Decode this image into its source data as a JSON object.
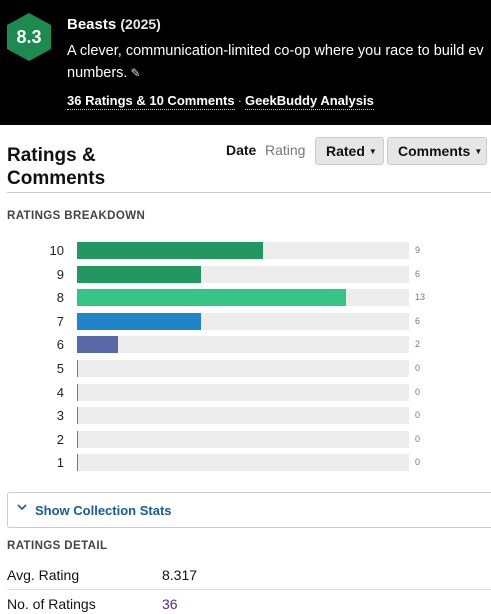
{
  "header": {
    "score": "8.3",
    "title": "Beasts",
    "year": "(2025)",
    "description": "A clever, communication-limited co-op where you race to build ev numbers.",
    "ratings_link": "36 Ratings & 10 Comments",
    "separator": "·",
    "analysis_link": "GeekBuddy Analysis"
  },
  "colors": {
    "header_bg": "#000000",
    "hex_fill": "#1d8a4f",
    "link_purple": "#5b2a86",
    "link_blue": "#1a5a9a"
  },
  "ratings_comments": {
    "title_line1": "Ratings &",
    "title_line2": "Comments",
    "sort_date": "Date",
    "sort_rating": "Rating",
    "filter_rated": "Rated",
    "filter_comments": "Comments"
  },
  "breakdown": {
    "heading": "RATINGS BREAKDOWN",
    "max": 13,
    "rows": [
      {
        "label": "10",
        "count": "9",
        "value": 9,
        "color": "#239760"
      },
      {
        "label": "9",
        "count": "6",
        "value": 6,
        "color": "#239760"
      },
      {
        "label": "8",
        "count": "13",
        "value": 13,
        "color": "#34c485"
      },
      {
        "label": "7",
        "count": "6",
        "value": 6,
        "color": "#1f85c8"
      },
      {
        "label": "6",
        "count": "2",
        "value": 2,
        "color": "#5a68a8"
      },
      {
        "label": "5",
        "count": "0",
        "value": 0,
        "color": "#d9534f"
      },
      {
        "label": "4",
        "count": "0",
        "value": 0,
        "color": "#d9534f"
      },
      {
        "label": "3",
        "count": "0",
        "value": 0,
        "color": "#d9534f"
      },
      {
        "label": "2",
        "count": "0",
        "value": 0,
        "color": "#d9534f"
      },
      {
        "label": "1",
        "count": "0",
        "value": 0,
        "color": "#d9534f"
      }
    ]
  },
  "collection": {
    "chevron_icon": "chevron-down-icon",
    "label": "Show Collection Stats"
  },
  "detail": {
    "heading": "RATINGS DETAIL",
    "avg_label": "Avg. Rating",
    "avg_value": "8.317",
    "num_label": "No. of Ratings",
    "num_value": "36"
  }
}
